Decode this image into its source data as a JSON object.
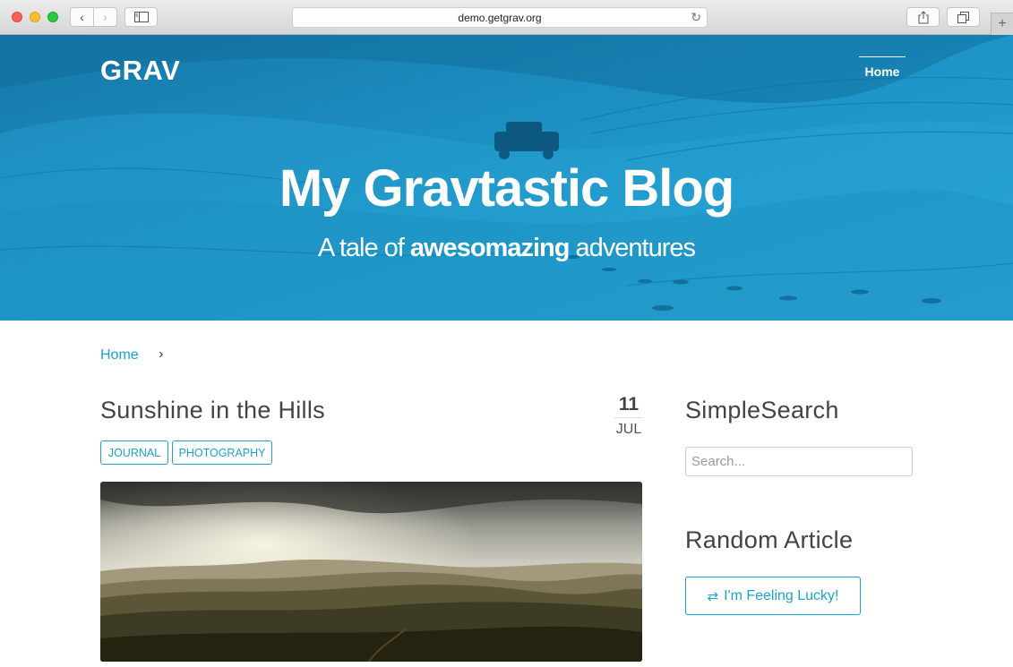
{
  "browser": {
    "url": "demo.getgrav.org",
    "back_icon": "chevron-left-icon",
    "forward_icon": "chevron-right-icon",
    "sidebar_icon": "sidebar-icon",
    "reload_icon": "reload-icon",
    "share_icon": "share-icon",
    "tabs_icon": "tabs-icon",
    "new_tab_icon": "plus-icon"
  },
  "site": {
    "logo": "GRAV",
    "nav": [
      {
        "label": "Home",
        "active": true
      }
    ]
  },
  "hero": {
    "title": "My Gravtastic Blog",
    "subtitle_pre": "A tale of ",
    "subtitle_bold": "awesomazing",
    "subtitle_post": " adventures"
  },
  "breadcrumb": {
    "items": [
      "Home"
    ],
    "separator": "›"
  },
  "post": {
    "title": "Sunshine in the Hills",
    "date_day": "11",
    "date_month": "JUL",
    "tags": [
      "JOURNAL",
      "PHOTOGRAPHY"
    ]
  },
  "sidebar": {
    "search_heading": "SimpleSearch",
    "search_placeholder": "Search...",
    "random_heading": "Random Article",
    "random_button": "I'm Feeling Lucky!",
    "random_icon": "retweet-icon"
  },
  "colors": {
    "accent": "#1ba3d2",
    "hero_blue": "#1e93c6",
    "heading_text": "#444444"
  }
}
